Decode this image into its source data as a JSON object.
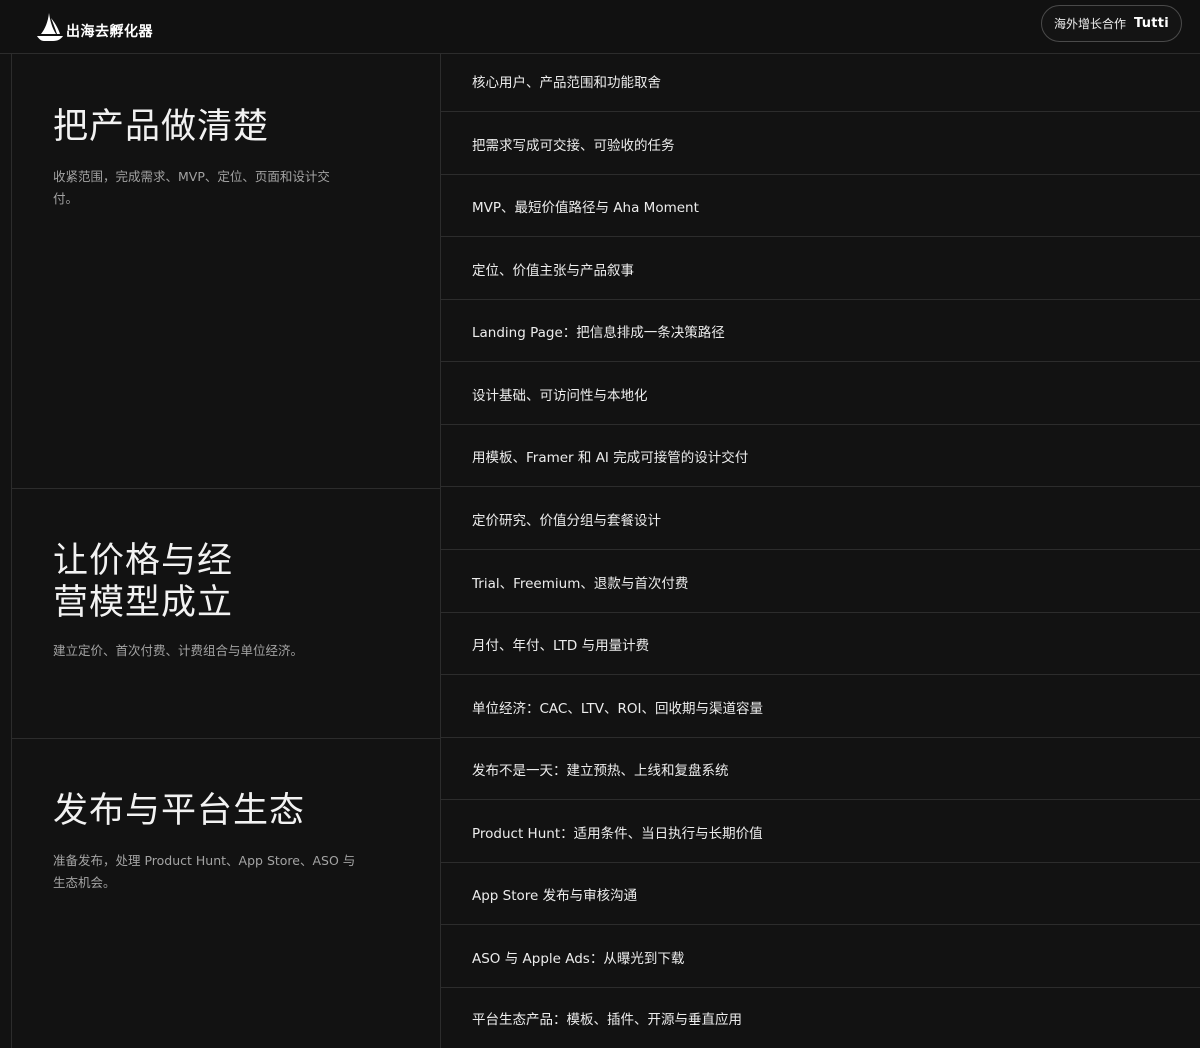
{
  "header": {
    "brand_name": "出海去孵化器",
    "pill_label": "海外增长合作",
    "pill_logo_text": "Tutti",
    "logo_icon": "sailboat-icon"
  },
  "sections": [
    {
      "title": "把产品做清楚",
      "description": "收紧范围，完成需求、MVP、定位、页面和设计交付。",
      "items": [
        "核心用户、产品范围和功能取舍",
        "把需求写成可交接、可验收的任务",
        "MVP、最短价值路径与 Aha Moment",
        "定位、价值主张与产品叙事",
        "Landing Page：把信息排成一条决策路径",
        "设计基础、可访问性与本地化",
        "用模板、Framer 和 AI 完成可接管的设计交付"
      ]
    },
    {
      "title_line1": "让价格与经",
      "title_line2": "营模型成立",
      "description": "建立定价、首次付费、计费组合与单位经济。",
      "items": [
        "定价研究、价值分组与套餐设计",
        "Trial、Freemium、退款与首次付费",
        "月付、年付、LTD 与用量计费",
        "单位经济：CAC、LTV、ROI、回收期与渠道容量"
      ]
    },
    {
      "title": "发布与平台生态",
      "description_line1": "准备发布，处理 Product Hunt、App Store、ASO 与",
      "description_line2": "生态机会。",
      "items": [
        "发布不是一天：建立预热、上线和复盘系统",
        "Product Hunt：适用条件、当日执行与长期价值",
        "App Store 发布与审核沟通",
        "ASO 与 Apple Ads：从曝光到下载",
        "平台生态产品：模板、插件、开源与垂直应用"
      ]
    }
  ]
}
